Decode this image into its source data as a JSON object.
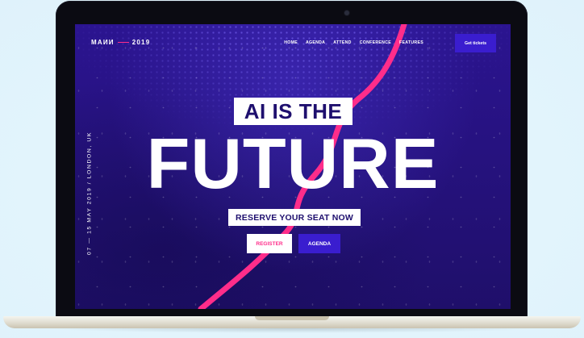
{
  "site": {
    "logo_text": "MAИИ",
    "logo_year": "2019"
  },
  "nav": {
    "items": [
      "HOME",
      "AGENDA",
      "ATTEND",
      "CONFERENCE",
      "FEATURES"
    ],
    "tickets_label": "Get tickets"
  },
  "event": {
    "date_location": "07 — 15 MAY 2019 / LONDON, UK"
  },
  "hero": {
    "kicker": "AI IS THE",
    "headline": "FUTURE",
    "subhead": "RESERVE YOUR SEAT NOW",
    "register_label": "REGISTER",
    "agenda_label": "AGENDA"
  },
  "colors": {
    "background": "#26127f",
    "accent_pink": "#ff2d8a",
    "button_blue": "#3a1dcf",
    "ink_dark": "#1e0f6e"
  },
  "icons": {
    "camera": "webcam-dot"
  }
}
